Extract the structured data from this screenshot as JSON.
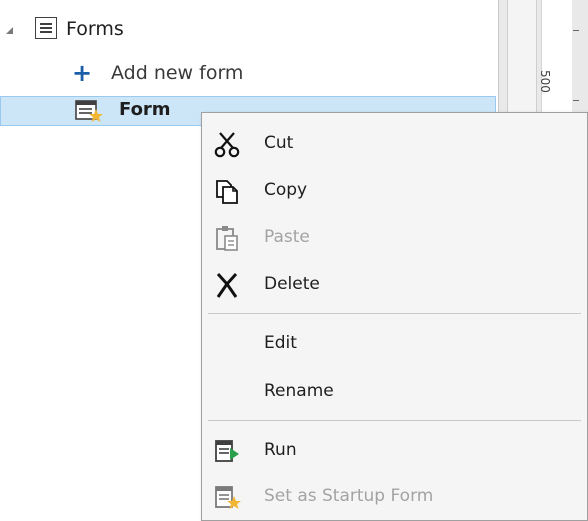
{
  "tree": {
    "forms_label": "Forms",
    "add_label": "Add new form",
    "form_label": "Form"
  },
  "ruler": {
    "number": "500"
  },
  "context_menu": {
    "cut": "Cut",
    "copy": "Copy",
    "paste": "Paste",
    "delete": "Delete",
    "edit": "Edit",
    "rename": "Rename",
    "run": "Run",
    "set_startup": "Set as Startup Form"
  },
  "colors": {
    "selection": "#cde6f7",
    "selection_border": "#99c9ef",
    "plus_icon": "#1c5fa8",
    "run_arrow": "#2aa04a",
    "star": "#f2b632",
    "disabled_text": "#a3a3a3"
  },
  "icons": [
    "expand-arrow-icon",
    "forms-icon",
    "plus-icon",
    "form-star-icon",
    "scissors-icon",
    "copy-icon",
    "paste-icon",
    "delete-x-icon",
    "run-icon",
    "startup-form-icon"
  ]
}
